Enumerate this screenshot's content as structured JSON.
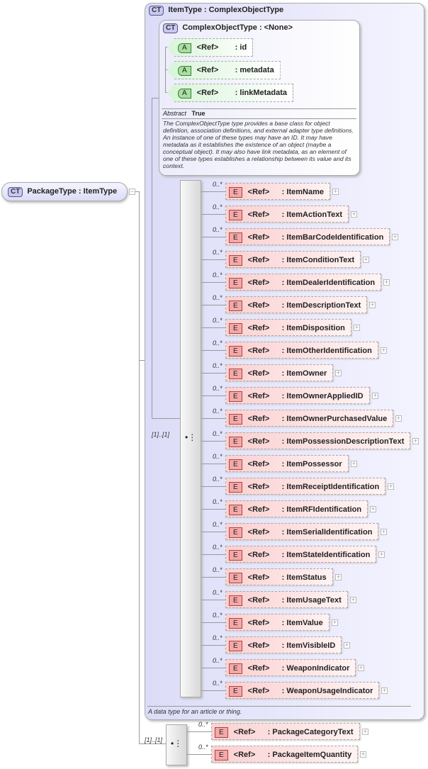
{
  "root": {
    "badge": "CT",
    "name": "PackageType",
    "type": "ItemType"
  },
  "item_type": {
    "badge": "CT",
    "name": "ItemType",
    "type": "ComplexObjectType",
    "doc": "A data type for an article or thing.",
    "seq_card": "[1]..[1]"
  },
  "complex_object_type": {
    "badge": "CT",
    "name": "ComplexObjectType",
    "type": "<None>",
    "abstract_label": "Abstract",
    "abstract_value": "True",
    "doc": "The ComplexObjectType type provides a base class for object definition, association definitions, and external adapter type definitions. An instance of one of these types may have an ID. It may have metadata as it establishes the existence of an object (maybe a conceptual object). It may also have link metadata, as an element of one of these types establishes a relationship between its value and its context.",
    "attributes": [
      {
        "badge": "A",
        "ref": "<Ref>",
        "name": ": id"
      },
      {
        "badge": "A",
        "ref": "<Ref>",
        "name": ": metadata"
      },
      {
        "badge": "A",
        "ref": "<Ref>",
        "name": ": linkMetadata"
      }
    ]
  },
  "item_elements": [
    "ItemName",
    "ItemActionText",
    "ItemBarCodeIdentification",
    "ItemConditionText",
    "ItemDealerIdentification",
    "ItemDescriptionText",
    "ItemDisposition",
    "ItemOtherIdentification",
    "ItemOwner",
    "ItemOwnerAppliedID",
    "ItemOwnerPurchasedValue",
    "ItemPossessionDescriptionText",
    "ItemPossessor",
    "ItemReceiptIdentification",
    "ItemRFIdentification",
    "ItemSerialIdentification",
    "ItemStateIdentification",
    "ItemStatus",
    "ItemUsageText",
    "ItemValue",
    "ItemVisibleID",
    "WeaponIndicator",
    "WeaponUsageIndicator"
  ],
  "package_seq_card": "[1]..[1]",
  "package_elements": [
    "PackageCategoryText",
    "PackageItemQuantity"
  ],
  "element_badge": "E",
  "ref_label": "<Ref>",
  "card": "0..*",
  "plus": "+",
  "minus": "−"
}
